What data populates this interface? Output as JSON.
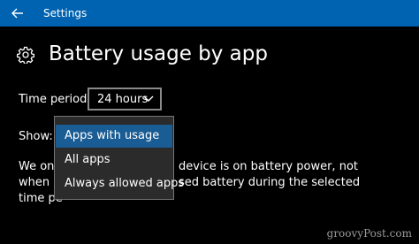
{
  "window": {
    "title": "Settings",
    "accent_color": "#0063b1"
  },
  "header": {
    "icon": "gear-icon",
    "title": "Battery usage by app"
  },
  "time_period": {
    "label": "Time period:",
    "selected": "24 hours"
  },
  "show": {
    "label": "Show:",
    "options": [
      "Apps with usage",
      "All apps",
      "Always allowed apps"
    ],
    "highlighted_option": "Apps with usage",
    "highlight_color": "#1a5c94"
  },
  "description": {
    "line1": "We only",
    "line1_end": "device is on battery power, not",
    "line2": "when it",
    "line2_end": "sed battery during the selected",
    "line3": "time pe"
  },
  "watermark": "groovyPost.com"
}
